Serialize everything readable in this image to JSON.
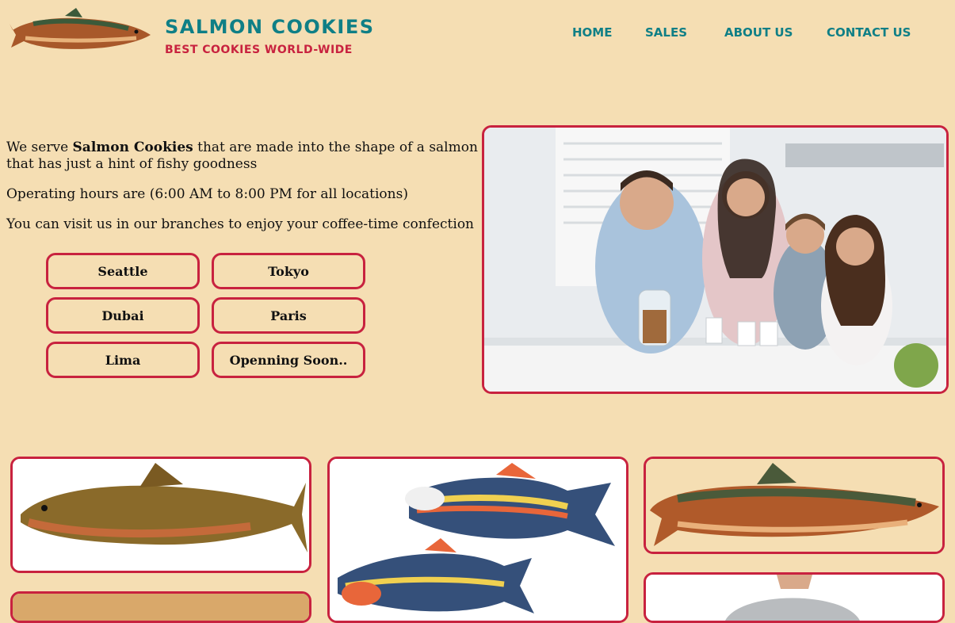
{
  "header": {
    "logo_icon": "salmon-logo-icon",
    "title": "Salmon Cookies",
    "subtitle": "Best Cookies World-Wide",
    "nav": [
      "Home",
      "Sales",
      "About Us",
      "Contact Us"
    ]
  },
  "intro": {
    "p1_before": "We serve ",
    "p1_bold": "Salmon Cookies",
    "p1_after": " that are made into the shape of a salmon that has just a hint of fishy goodness",
    "p2": "Operating hours are (6:00 AM to 8:00 PM for all locations)",
    "p3": "You can visit us in our branches to enjoy your coffee-time confection"
  },
  "branches": [
    "Seattle",
    "Tokyo",
    "Dubai",
    "Paris",
    "Lima",
    "Openning Soon.."
  ],
  "images": {
    "hero": "family-photo",
    "gallery": [
      "trout-illustration",
      "fish-cookies-photo",
      "salmon-illustration",
      "person-photo",
      "wood-photo"
    ]
  },
  "colors": {
    "background": "#f5deb3",
    "accent": "#c8223f",
    "brand": "#0f7f86"
  }
}
